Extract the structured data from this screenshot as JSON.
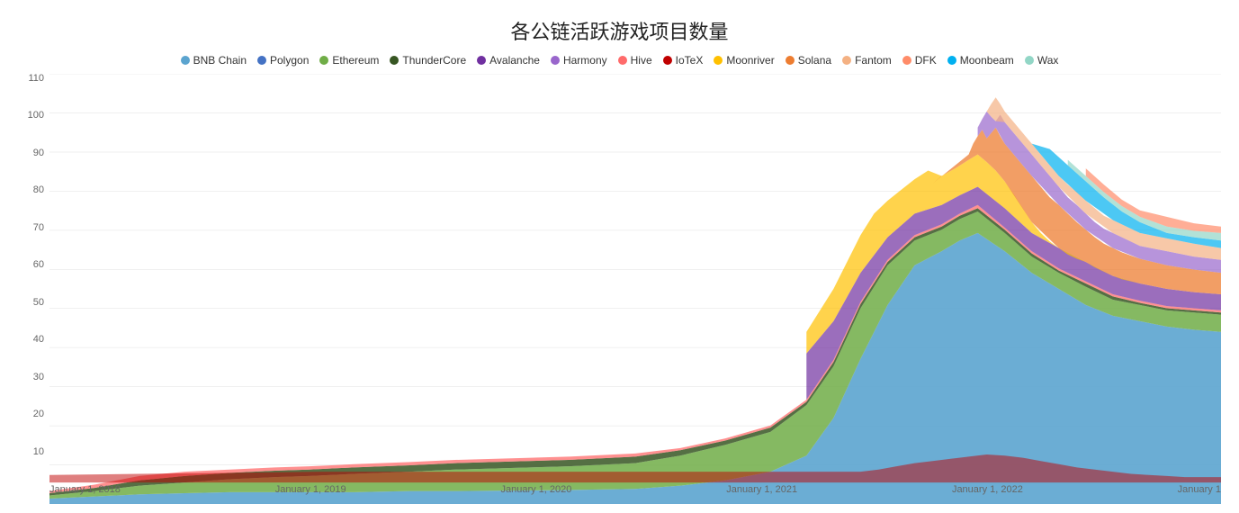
{
  "title": "各公链活跃游戏项目数量",
  "legend": [
    {
      "label": "BNB Chain",
      "color": "#5BA4CF"
    },
    {
      "label": "Polygon",
      "color": "#4472C4"
    },
    {
      "label": "Ethereum",
      "color": "#70AD47"
    },
    {
      "label": "ThunderCore",
      "color": "#375623"
    },
    {
      "label": "Avalanche",
      "color": "#7030A0"
    },
    {
      "label": "Harmony",
      "color": "#9966CC"
    },
    {
      "label": "Hive",
      "color": "#FF6B6B"
    },
    {
      "label": "IoTeX",
      "color": "#C00000"
    },
    {
      "label": "Moonriver",
      "color": "#FFC000"
    },
    {
      "label": "Solana",
      "color": "#ED7D31"
    },
    {
      "label": "Fantom",
      "color": "#F4B183"
    },
    {
      "label": "DFK",
      "color": "#FF8C69"
    },
    {
      "label": "Moonbeam",
      "color": "#00B0F0"
    },
    {
      "label": "Wax",
      "color": "#92D6C6"
    }
  ],
  "yAxis": {
    "labels": [
      "110",
      "100",
      "90",
      "80",
      "70",
      "60",
      "50",
      "40",
      "30",
      "20",
      "10",
      ""
    ]
  },
  "xAxis": {
    "labels": [
      "January 1, 2018",
      "January 1, 2019",
      "January 1, 2020",
      "January 1, 2021",
      "January 1, 2022",
      "January 1"
    ]
  }
}
